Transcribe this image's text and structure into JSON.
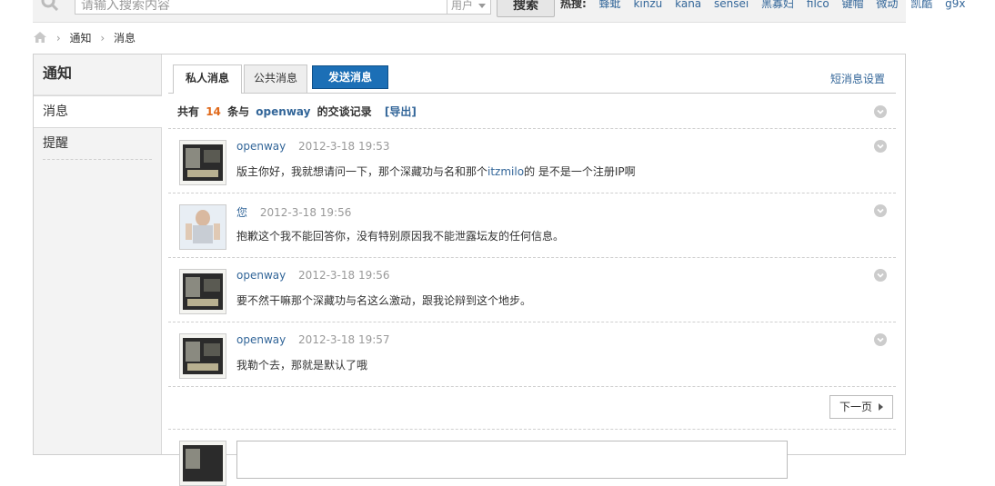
{
  "search": {
    "placeholder": "请输入搜索内容",
    "type": "用户",
    "button": "搜索",
    "hot_label": "热搜:",
    "hot_terms": [
      "蜂蚍",
      "kinzu",
      "kana",
      "sensei",
      "黑寡妇",
      "filco",
      "键帽",
      "微动",
      "凯酷",
      "g9x"
    ]
  },
  "breadcrumb": {
    "items": [
      "通知",
      "消息"
    ]
  },
  "sidebar": {
    "title": "通知",
    "items": [
      {
        "label": "消息"
      },
      {
        "label": "提醒"
      }
    ]
  },
  "tabs": {
    "private": "私人消息",
    "public": "公共消息",
    "send": "发送消息",
    "settings": "短消息设置"
  },
  "summary": {
    "prefix": "共有",
    "count": "14",
    "middle": "条与",
    "user": "openway",
    "suffix": "的交谈记录",
    "export": "[导出]"
  },
  "messages": [
    {
      "author": "openway",
      "time": "2012-3-18 19:53",
      "text_before": "版主你好，我就想请问一下，那个深藏功与名和那个",
      "highlight": "itzmilo",
      "text_after": "的 是不是一个注册IP啊"
    },
    {
      "author": "您",
      "time": "2012-3-18 19:56",
      "text_before": "抱歉这个我不能回答你，没有特别原因我不能泄露坛友的任何信息。",
      "highlight": "",
      "text_after": ""
    },
    {
      "author": "openway",
      "time": "2012-3-18 19:56",
      "text_before": "要不然干嘛那个深藏功与名这么激动，跟我论辩到这个地步。",
      "highlight": "",
      "text_after": ""
    },
    {
      "author": "openway",
      "time": "2012-3-18 19:57",
      "text_before": "我勒个去，那就是默认了哦",
      "highlight": "",
      "text_after": ""
    }
  ],
  "pager": {
    "next": "下一页"
  },
  "colors": {
    "link": "#336699",
    "accent_count": "#e06a1c",
    "send_button": "#1c6fb6"
  }
}
